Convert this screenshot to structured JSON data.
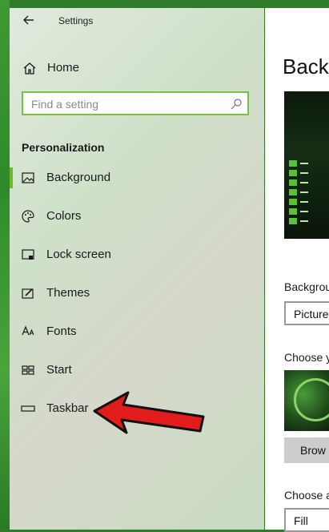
{
  "window": {
    "title": "Settings"
  },
  "nav": {
    "home_label": "Home",
    "search_placeholder": "Find a setting",
    "section_title": "Personalization",
    "items": [
      {
        "label": "Background",
        "icon": "picture-icon",
        "selected": true
      },
      {
        "label": "Colors",
        "icon": "palette-icon",
        "selected": false
      },
      {
        "label": "Lock screen",
        "icon": "lock-screen-icon",
        "selected": false
      },
      {
        "label": "Themes",
        "icon": "brush-icon",
        "selected": false
      },
      {
        "label": "Fonts",
        "icon": "font-icon",
        "selected": false
      },
      {
        "label": "Start",
        "icon": "start-icon",
        "selected": false
      },
      {
        "label": "Taskbar",
        "icon": "taskbar-icon",
        "selected": false
      }
    ]
  },
  "content": {
    "title": "Backg",
    "background_label": "Backgrou",
    "background_value": "Picture",
    "choose_picture_label": "Choose y",
    "browse_label": "Brow",
    "choose_fit_label": "Choose a",
    "fit_value": "Fill"
  },
  "colors": {
    "accent": "#76b82a",
    "annotation_arrow": "#e21b1b"
  }
}
